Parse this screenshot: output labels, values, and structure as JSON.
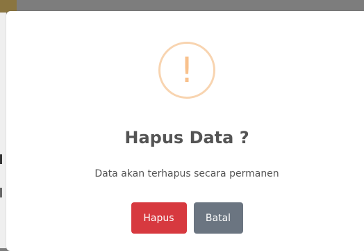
{
  "dialog": {
    "icon": "warning-exclamation-icon",
    "icon_glyph": "!",
    "title": "Hapus Data ?",
    "message": "Data akan terhapus secara permanen",
    "confirm_label": "Hapus",
    "cancel_label": "Batal"
  },
  "colors": {
    "confirm_button": "#d7393f",
    "cancel_button": "#6b7581",
    "icon_border": "#f8d4b0",
    "icon_glyph": "#f8c18c",
    "text": "#545454"
  }
}
